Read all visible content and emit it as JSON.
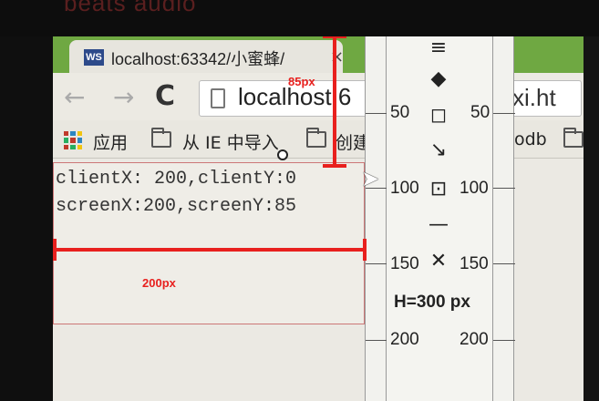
{
  "brand": "beats audio",
  "browser": {
    "tab_title": "localhost:63342/小蜜蜂/",
    "tab_close": "×",
    "back": "←",
    "forward": "→",
    "reload": "C",
    "url": "localhost:6",
    "url_tail": "jiexi.ht",
    "bookmarks": [
      "应用",
      "从 IE 中导入",
      "创建",
      "odb"
    ]
  },
  "page": {
    "line1": "clientX: 200,clientY:0",
    "line2": "screenX:200,screenY:85"
  },
  "measure_tool": {
    "ruler_labels_left": [
      "50",
      "100",
      "150",
      "200"
    ],
    "ruler_labels_right": [
      "50",
      "100",
      "150",
      "200"
    ],
    "height_label": "H=300 px",
    "tools": [
      "≡",
      "◆",
      "◻",
      "↘",
      "⊡",
      "—",
      "✕"
    ]
  },
  "annotations": {
    "vertical": "85px",
    "horizontal": "200px"
  }
}
